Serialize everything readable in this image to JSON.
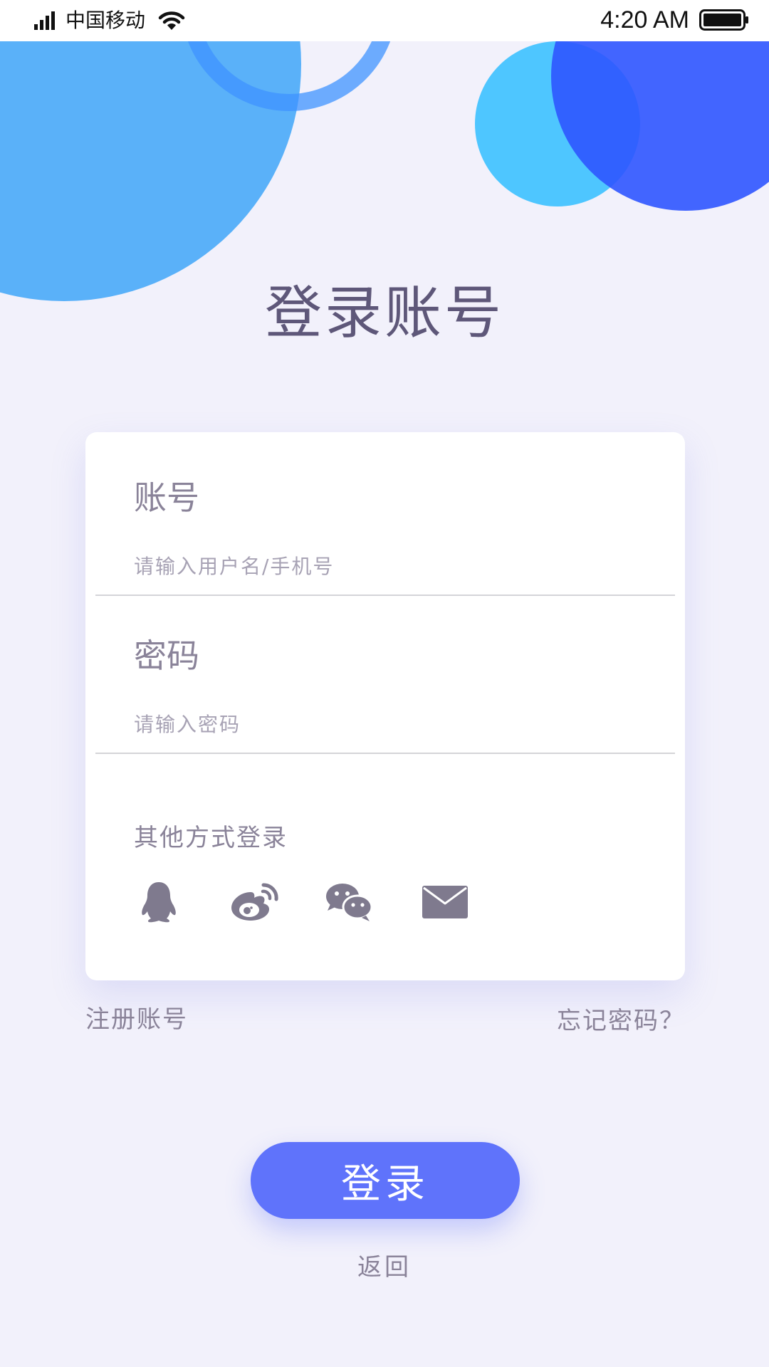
{
  "status_bar": {
    "carrier": "中国移动",
    "time": "4:20 AM"
  },
  "page": {
    "title": "登录账号"
  },
  "form": {
    "account_label": "账号",
    "account_placeholder": "请输入用户名/手机号",
    "account_value": "",
    "password_label": "密码",
    "password_placeholder": "请输入密码",
    "password_value": "",
    "other_login_label": "其他方式登录",
    "social_logins": [
      "qq-icon",
      "weibo-icon",
      "wechat-icon",
      "email-icon"
    ]
  },
  "links": {
    "register": "注册账号",
    "forgot_password": "忘记密码？"
  },
  "actions": {
    "login": "登录",
    "back": "返回"
  },
  "colors": {
    "background": "#f2f1fb",
    "primary": "#5f73fb",
    "title_text": "#5e5779",
    "label_text": "#8a8399",
    "icon": "#7f7a8e",
    "decor_light_blue": "#5ab1f9",
    "decor_cyan": "#4ec6ff",
    "decor_royal_blue": "#3b5bff"
  }
}
